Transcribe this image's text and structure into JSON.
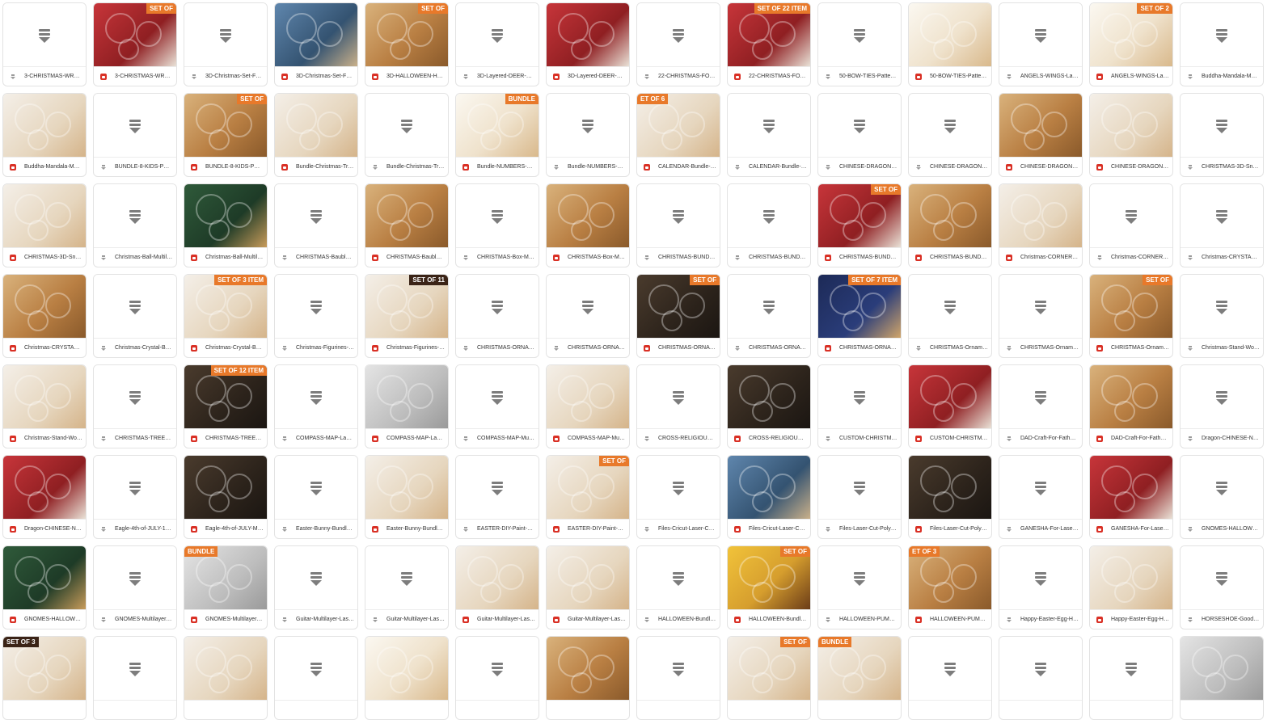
{
  "colors": {
    "image_icon": "#d93025",
    "generic_icon": "#7d7d7d",
    "border": "#e3e3e3",
    "badge": "#e8792a"
  },
  "icons": {
    "file": "file-download-icon",
    "image": "image-file-icon"
  },
  "tiles": [
    {
      "name": "3-CHRISTMAS-WREA...",
      "kind": "file"
    },
    {
      "name": "3-CHRISTMAS-WREA...",
      "kind": "image",
      "swatch": "red",
      "badge": "SET OF"
    },
    {
      "name": "3D-Christmas-Set-For-...",
      "kind": "file"
    },
    {
      "name": "3D-Christmas-Set-For-...",
      "kind": "image",
      "swatch": "blue"
    },
    {
      "name": "3D-HALLOWEEN-HOU...",
      "kind": "image",
      "swatch": "wood",
      "badge": "SET OF"
    },
    {
      "name": "3D-Layered-DEER-CH...",
      "kind": "file"
    },
    {
      "name": "3D-Layered-DEER-CH...",
      "kind": "image",
      "swatch": "red"
    },
    {
      "name": "22-CHRISTMAS-FOLK-...",
      "kind": "file"
    },
    {
      "name": "22-CHRISTMAS-FOLK-...",
      "kind": "image",
      "swatch": "red",
      "badge": "SET OF 22 ITEM"
    },
    {
      "name": "50-BOW-TIES-Pattern...",
      "kind": "file"
    },
    {
      "name": "50-BOW-TIES-Pattern...",
      "kind": "image",
      "swatch": "cream"
    },
    {
      "name": "ANGELS-WINGS-Laser-...",
      "kind": "file"
    },
    {
      "name": "ANGELS-WINGS-Laser-...",
      "kind": "image",
      "swatch": "cream",
      "badge": "SET OF 2"
    },
    {
      "name": "Buddha-Mandala-Mult...",
      "kind": "file"
    },
    {
      "name": "Buddha-Mandala-Mult...",
      "kind": "image",
      "swatch": "light"
    },
    {
      "name": "BUNDLE-8-KIDS-PUZZ...",
      "kind": "file"
    },
    {
      "name": "BUNDLE-8-KIDS-PUZZ...",
      "kind": "image",
      "swatch": "wood",
      "badge": "SET OF"
    },
    {
      "name": "Bundle-Christmas-Tre...",
      "kind": "image",
      "swatch": "light"
    },
    {
      "name": "Bundle-Christmas-Tre...",
      "kind": "file"
    },
    {
      "name": "Bundle-NUMBERS-Mul...",
      "kind": "image",
      "swatch": "cream",
      "badge": "BUNDLE"
    },
    {
      "name": "Bundle-NUMBERS-Mul...",
      "kind": "file"
    },
    {
      "name": "CALENDAR-Bundle-La...",
      "kind": "image",
      "swatch": "light",
      "badge": "ET OF 6",
      "badgeLeft": true
    },
    {
      "name": "CALENDAR-Bundle-La...",
      "kind": "file"
    },
    {
      "name": "CHINESE-DRAGON-M...",
      "kind": "file"
    },
    {
      "name": "CHINESE-DRAGON-M...",
      "kind": "file"
    },
    {
      "name": "CHINESE-DRAGON-M...",
      "kind": "image",
      "swatch": "wood"
    },
    {
      "name": "CHINESE-DRAGON-M...",
      "kind": "image",
      "swatch": "light"
    },
    {
      "name": "CHRISTMAS-3D-Snow...",
      "kind": "file"
    },
    {
      "name": "CHRISTMAS-3D-Snow...",
      "kind": "image",
      "swatch": "light"
    },
    {
      "name": "Christmas-Ball-Multila...",
      "kind": "file"
    },
    {
      "name": "Christmas-Ball-Multila...",
      "kind": "image",
      "swatch": "green"
    },
    {
      "name": "CHRISTMAS-Baubles-...",
      "kind": "file"
    },
    {
      "name": "CHRISTMAS-Baubles-...",
      "kind": "image",
      "swatch": "wood"
    },
    {
      "name": "CHRISTMAS-Box-Mult...",
      "kind": "file"
    },
    {
      "name": "CHRISTMAS-Box-Mult...",
      "kind": "image",
      "swatch": "wood"
    },
    {
      "name": "CHRISTMAS-BUNDLE-...",
      "kind": "file"
    },
    {
      "name": "CHRISTMAS-BUNDLE-...",
      "kind": "file"
    },
    {
      "name": "CHRISTMAS-BUNDLE-...",
      "kind": "image",
      "swatch": "red",
      "badge": "SET OF"
    },
    {
      "name": "CHRISTMAS-BUNDLE-...",
      "kind": "image",
      "swatch": "wood"
    },
    {
      "name": "Christmas-CORNER-fo...",
      "kind": "image",
      "swatch": "light"
    },
    {
      "name": "Christmas-CORNER-fo...",
      "kind": "file"
    },
    {
      "name": "Christmas-CRYSTAL-B...",
      "kind": "file"
    },
    {
      "name": "Christmas-CRYSTAL-B...",
      "kind": "image",
      "swatch": "wood"
    },
    {
      "name": "Christmas-Crystal-Ball...",
      "kind": "file"
    },
    {
      "name": "Christmas-Crystal-Ball...",
      "kind": "image",
      "swatch": "light",
      "badge": "SET OF 3 ITEM"
    },
    {
      "name": "Christmas-Figurines-B...",
      "kind": "file"
    },
    {
      "name": "Christmas-Figurines-B...",
      "kind": "image",
      "swatch": "light",
      "badge": "SET OF 11",
      "badgeDark": true
    },
    {
      "name": "CHRISTMAS-ORNAME...",
      "kind": "file"
    },
    {
      "name": "CHRISTMAS-ORNAME...",
      "kind": "file"
    },
    {
      "name": "CHRISTMAS-ORNAME...",
      "kind": "image",
      "swatch": "dark",
      "badge": "SET OF"
    },
    {
      "name": "CHRISTMAS-ORNAME...",
      "kind": "file"
    },
    {
      "name": "CHRISTMAS-ORNAME...",
      "kind": "image",
      "swatch": "navy",
      "badge": "SET OF 7 ITEM"
    },
    {
      "name": "CHRISTMAS-Ornamen...",
      "kind": "file"
    },
    {
      "name": "CHRISTMAS-Ornamen...",
      "kind": "file"
    },
    {
      "name": "CHRISTMAS-Ornamen...",
      "kind": "image",
      "swatch": "wood",
      "badge": "SET OF"
    },
    {
      "name": "Christmas-Stand-Woo...",
      "kind": "file"
    },
    {
      "name": "Christmas-Stand-Woo...",
      "kind": "image",
      "swatch": "light"
    },
    {
      "name": "CHRISTMAS-TREES-B...",
      "kind": "file"
    },
    {
      "name": "CHRISTMAS-TREES-B...",
      "kind": "image",
      "swatch": "dark",
      "badge": "SET OF 12 ITEM"
    },
    {
      "name": "COMPASS-MAP-Laser-...",
      "kind": "file"
    },
    {
      "name": "COMPASS-MAP-Laser-...",
      "kind": "image",
      "swatch": "grey"
    },
    {
      "name": "COMPASS-MAP-Multil...",
      "kind": "file"
    },
    {
      "name": "COMPASS-MAP-Multil...",
      "kind": "image",
      "swatch": "light"
    },
    {
      "name": "CROSS-RELIGIOUS-W...",
      "kind": "file"
    },
    {
      "name": "CROSS-RELIGIOUS-W...",
      "kind": "image",
      "swatch": "dark"
    },
    {
      "name": "CUSTOM-CHRISTMAS...",
      "kind": "file"
    },
    {
      "name": "CUSTOM-CHRISTMAS...",
      "kind": "image",
      "swatch": "red"
    },
    {
      "name": "DAD-Craft-For-Fathers...",
      "kind": "file"
    },
    {
      "name": "DAD-Craft-For-Fathers...",
      "kind": "image",
      "swatch": "wood"
    },
    {
      "name": "Dragon-CHINESE-NEW...",
      "kind": "file"
    },
    {
      "name": "Dragon-CHINESE-NEW...",
      "kind": "image",
      "swatch": "red"
    },
    {
      "name": "Eagle-4th-of-JULY-129...",
      "kind": "file"
    },
    {
      "name": "Eagle-4th-of-JULY-Mul...",
      "kind": "image",
      "swatch": "dark"
    },
    {
      "name": "Easter-Bunny-Bundle-...",
      "kind": "file"
    },
    {
      "name": "Easter-Bunny-Bundle-...",
      "kind": "image",
      "swatch": "light"
    },
    {
      "name": "EASTER-DIY-Paint-Kit-...",
      "kind": "file"
    },
    {
      "name": "EASTER-DIY-Paint-Kit-...",
      "kind": "image",
      "swatch": "light",
      "badge": "SET OF"
    },
    {
      "name": "Files-Cricut-Laser-Cut-...",
      "kind": "file"
    },
    {
      "name": "Files-Cricut-Laser-Cut-...",
      "kind": "image",
      "swatch": "blue"
    },
    {
      "name": "Files-Laser-Cut-Polyg...",
      "kind": "file"
    },
    {
      "name": "Files-Laser-Cut-Polyg...",
      "kind": "image",
      "swatch": "dark"
    },
    {
      "name": "GANESHA-For-Laser-...",
      "kind": "file"
    },
    {
      "name": "GANESHA-For-Laser-...",
      "kind": "image",
      "swatch": "red"
    },
    {
      "name": "GNOMES-HALLOWEE...",
      "kind": "file"
    },
    {
      "name": "GNOMES-HALLOWEE...",
      "kind": "image",
      "swatch": "green"
    },
    {
      "name": "GNOMES-Multilayer-L...",
      "kind": "file"
    },
    {
      "name": "GNOMES-Multilayer-L...",
      "kind": "image",
      "swatch": "grey",
      "badge": "BUNDLE",
      "badgeLeft": true
    },
    {
      "name": "Guitar-Multilayer-Lase...",
      "kind": "file"
    },
    {
      "name": "Guitar-Multilayer-Lase...",
      "kind": "file"
    },
    {
      "name": "Guitar-Multilayer-Lase...",
      "kind": "image",
      "swatch": "light"
    },
    {
      "name": "Guitar-Multilayer-Lase...",
      "kind": "image",
      "swatch": "light"
    },
    {
      "name": "HALLOWEEN-Bundle-f...",
      "kind": "file"
    },
    {
      "name": "HALLOWEEN-Bundle-f...",
      "kind": "image",
      "swatch": "yellow",
      "badge": "SET OF"
    },
    {
      "name": "HALLOWEEN-PUMPKI...",
      "kind": "file"
    },
    {
      "name": "HALLOWEEN-PUMPKI...",
      "kind": "image",
      "swatch": "wood",
      "badge": "ET OF 3",
      "badgeLeft": true
    },
    {
      "name": "Happy-Easter-Egg-Hol...",
      "kind": "file"
    },
    {
      "name": "Happy-Easter-Egg-Hol...",
      "kind": "image",
      "swatch": "light"
    },
    {
      "name": "HORSESHOE-Good-Lu...",
      "kind": "file"
    },
    {
      "name": "",
      "kind": "image",
      "swatch": "light",
      "badge": "SET OF 3",
      "badgeLeft": true,
      "badgeDark": true,
      "partial": true
    },
    {
      "name": "",
      "kind": "file",
      "partial": true
    },
    {
      "name": "",
      "kind": "image",
      "swatch": "light",
      "partial": true
    },
    {
      "name": "",
      "kind": "file",
      "partial": true
    },
    {
      "name": "",
      "kind": "image",
      "swatch": "cream",
      "partial": true
    },
    {
      "name": "",
      "kind": "file",
      "partial": true
    },
    {
      "name": "",
      "kind": "image",
      "swatch": "wood",
      "partial": true
    },
    {
      "name": "",
      "kind": "file",
      "partial": true
    },
    {
      "name": "",
      "kind": "image",
      "swatch": "light",
      "badge": "SET OF",
      "partial": true
    },
    {
      "name": "",
      "kind": "image",
      "swatch": "light",
      "badge": "BUNDLE",
      "badgeLeft": true,
      "partial": true
    },
    {
      "name": "",
      "kind": "file",
      "partial": true
    },
    {
      "name": "",
      "kind": "file",
      "partial": true
    },
    {
      "name": "",
      "kind": "file",
      "partial": true
    },
    {
      "name": "",
      "kind": "image",
      "swatch": "grey",
      "partial": true
    }
  ]
}
